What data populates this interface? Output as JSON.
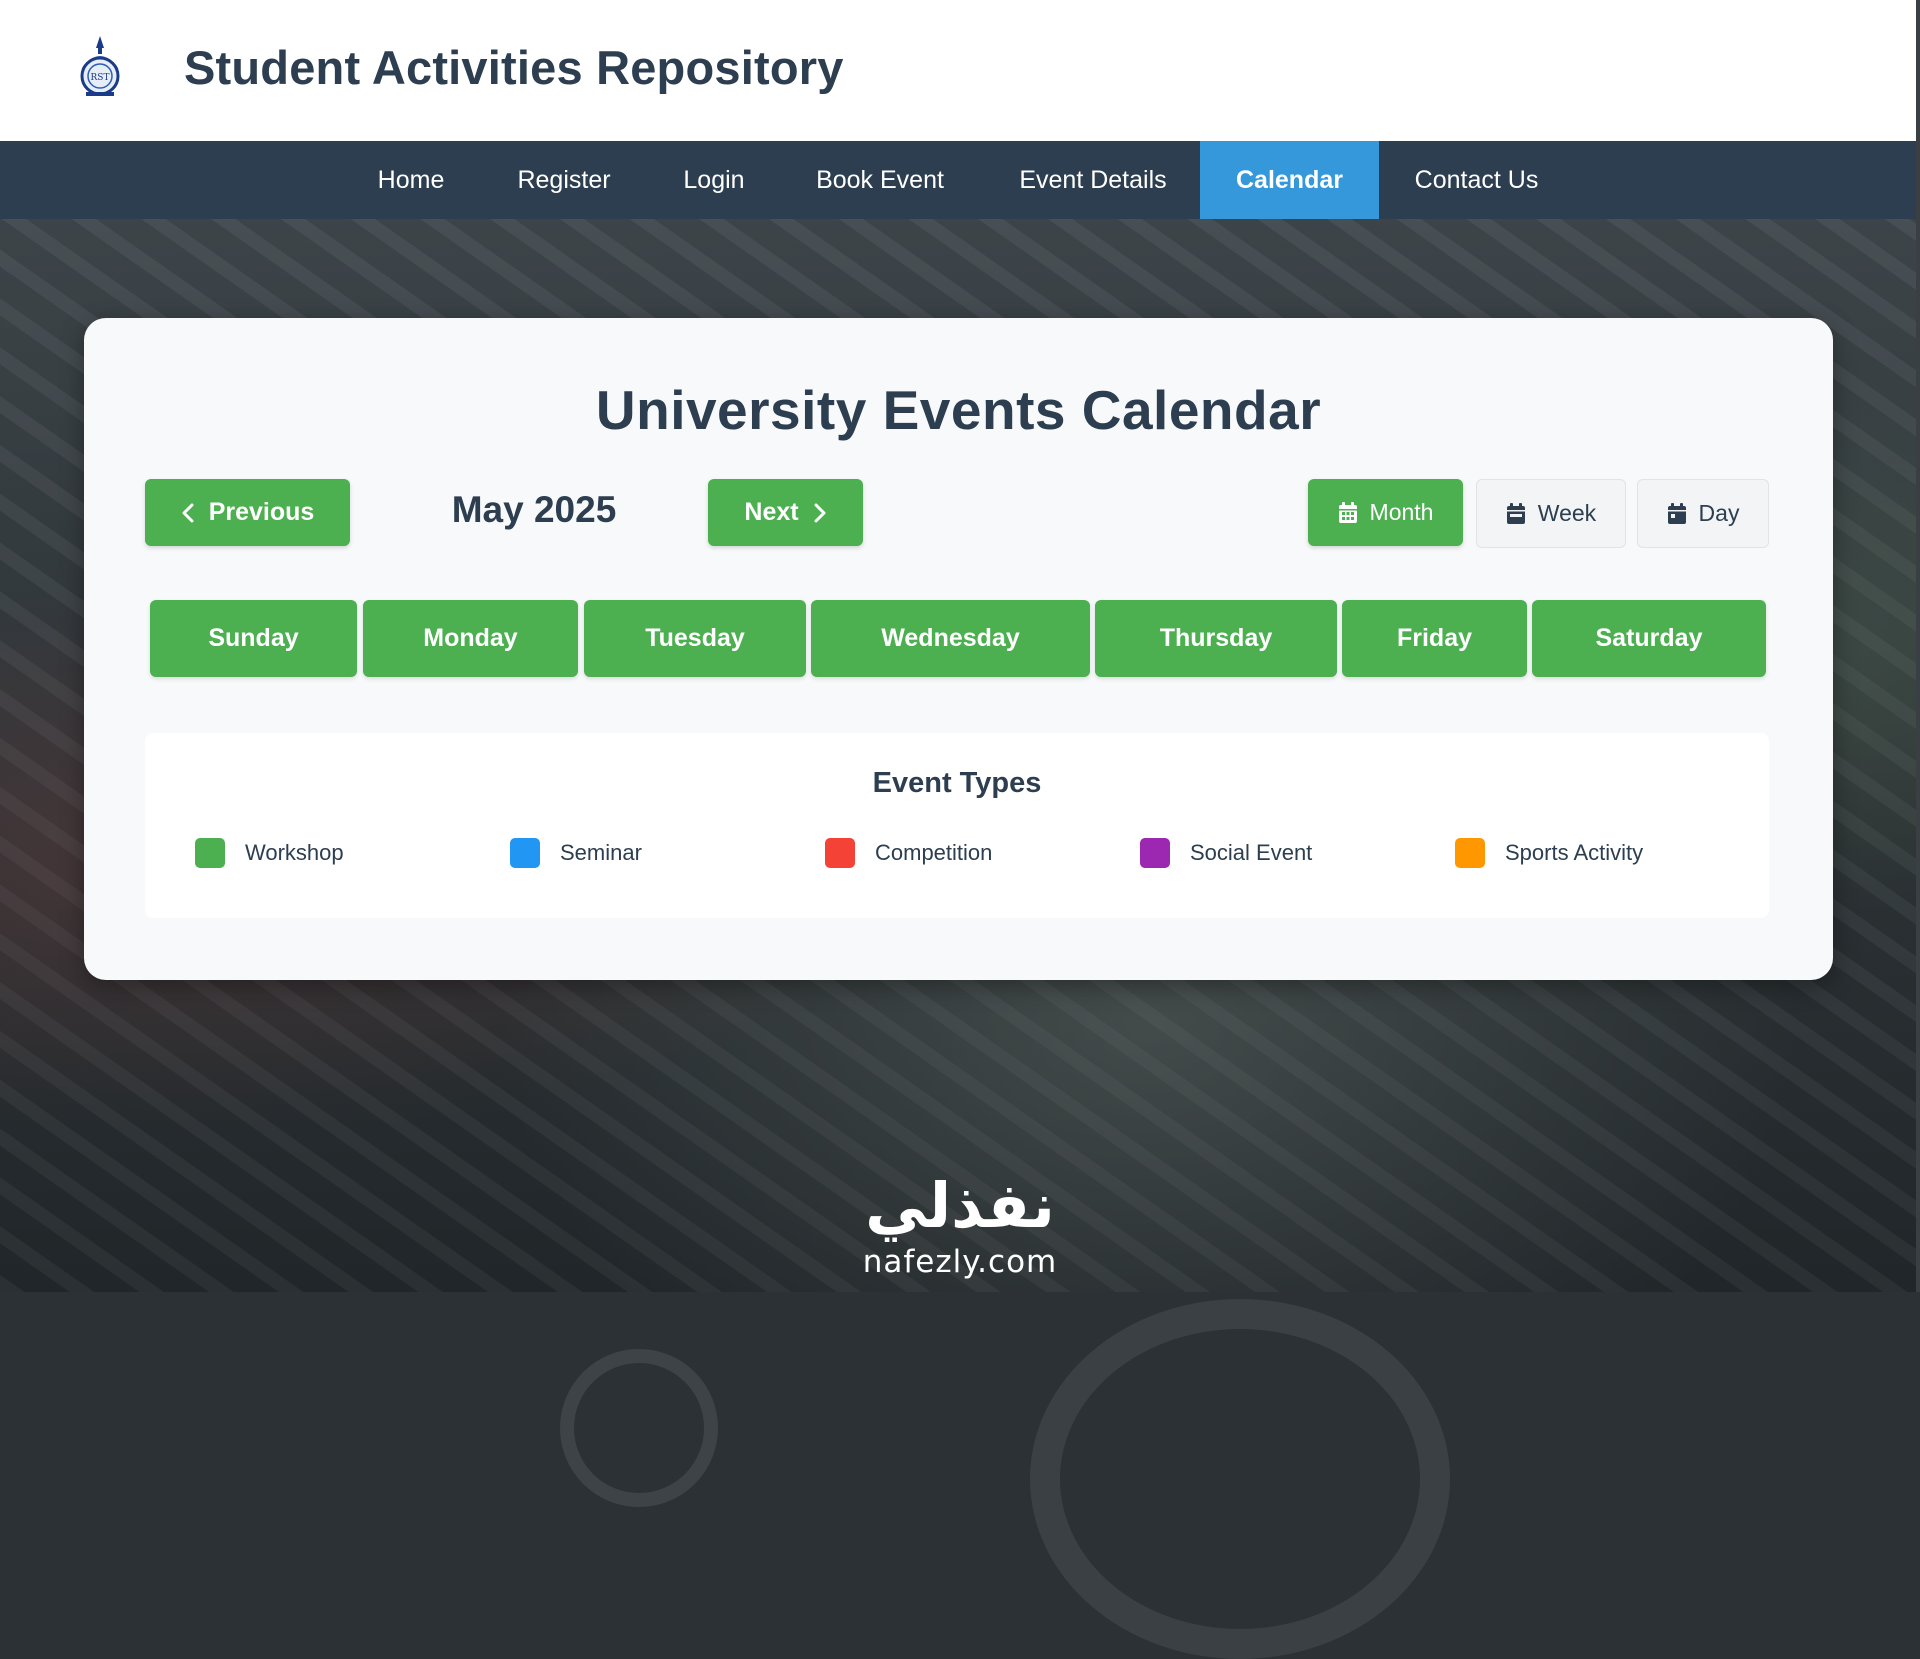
{
  "header": {
    "title": "Student Activities Repository",
    "logo_text": "RST"
  },
  "nav": {
    "items": [
      {
        "label": "Home"
      },
      {
        "label": "Register"
      },
      {
        "label": "Login"
      },
      {
        "label": "Book Event"
      },
      {
        "label": "Event Details"
      },
      {
        "label": "Calendar",
        "active": true
      },
      {
        "label": "Contact Us"
      }
    ]
  },
  "calendar": {
    "title": "University Events Calendar",
    "prev_label": "Previous",
    "next_label": "Next",
    "current_month": "May 2025",
    "views": [
      {
        "label": "Month",
        "icon": "calendar-icon",
        "active": true
      },
      {
        "label": "Week",
        "icon": "calendar-icon",
        "active": false
      },
      {
        "label": "Day",
        "icon": "calendar-icon",
        "active": false
      }
    ],
    "weekdays": [
      "Sunday",
      "Monday",
      "Tuesday",
      "Wednesday",
      "Thursday",
      "Friday",
      "Saturday"
    ]
  },
  "legend": {
    "title": "Event Types",
    "items": [
      {
        "label": "Workshop",
        "color": "#4caf50"
      },
      {
        "label": "Seminar",
        "color": "#2196f3"
      },
      {
        "label": "Competition",
        "color": "#f44336"
      },
      {
        "label": "Social Event",
        "color": "#9c27b0"
      },
      {
        "label": "Sports Activity",
        "color": "#ff9800"
      }
    ]
  },
  "watermark": {
    "arabic": "نفذلي",
    "latin": "nafezly.com"
  },
  "colors": {
    "nav_bg": "#2c3e50",
    "nav_active": "#3498db",
    "accent_green": "#4caf50",
    "text_dark": "#2c3e50"
  }
}
